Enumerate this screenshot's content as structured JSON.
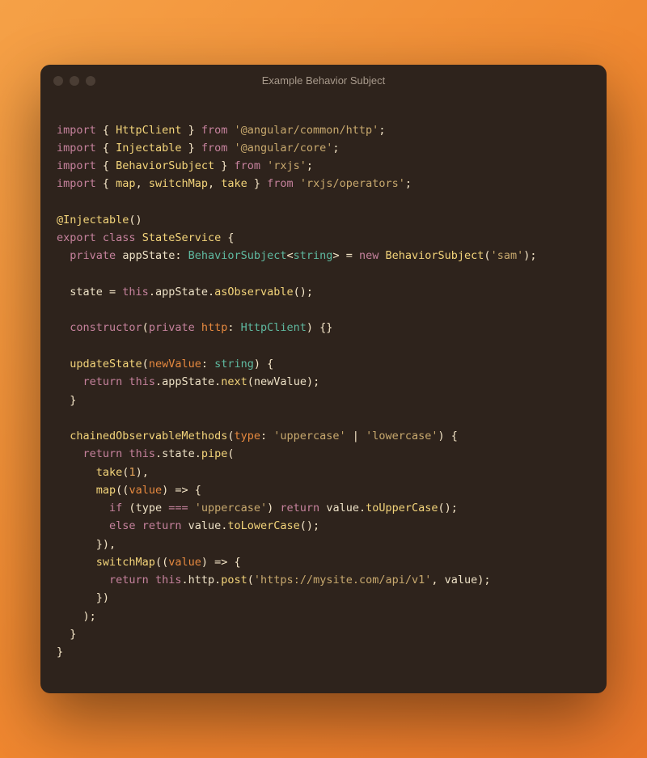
{
  "window": {
    "title": "Example Behavior Subject"
  },
  "code": {
    "l1_import": "import",
    "l1_httpclient": "HttpClient",
    "l1_from": "from",
    "l1_pkg": "'@angular/common/http'",
    "l2_injectable": "Injectable",
    "l2_pkg": "'@angular/core'",
    "l3_behaviorsubject": "BehaviorSubject",
    "l3_pkg": "'rxjs'",
    "l4_map": "map",
    "l4_switchmap": "switchMap",
    "l4_take": "take",
    "l4_pkg": "'rxjs/operators'",
    "decorator": "@Injectable",
    "export": "export",
    "class": "class",
    "classname": "StateService",
    "private": "private",
    "appstate": "appState",
    "behaviorsubject_type": "BehaviorSubject",
    "string_type": "string",
    "new": "new",
    "sam": "'sam'",
    "state": "state",
    "this": "this",
    "asobservable": "asObservable",
    "constructor": "constructor",
    "http": "http",
    "httpclient_type": "HttpClient",
    "updatestate": "updateState",
    "newvalue": "newValue",
    "return": "return",
    "next": "next",
    "chained": "chainedObservableMethods",
    "type_param": "type",
    "uppercase": "'uppercase'",
    "lowercase": "'lowercase'",
    "pipe": "pipe",
    "take_fn": "take",
    "one": "1",
    "map_fn": "map",
    "value": "value",
    "if": "if",
    "eqeqeq": "===",
    "touppercase": "toUpperCase",
    "else": "else",
    "tolowercase": "toLowerCase",
    "switchmap_fn": "switchMap",
    "post": "post",
    "url": "'https://mysite.com/api/v1'"
  }
}
